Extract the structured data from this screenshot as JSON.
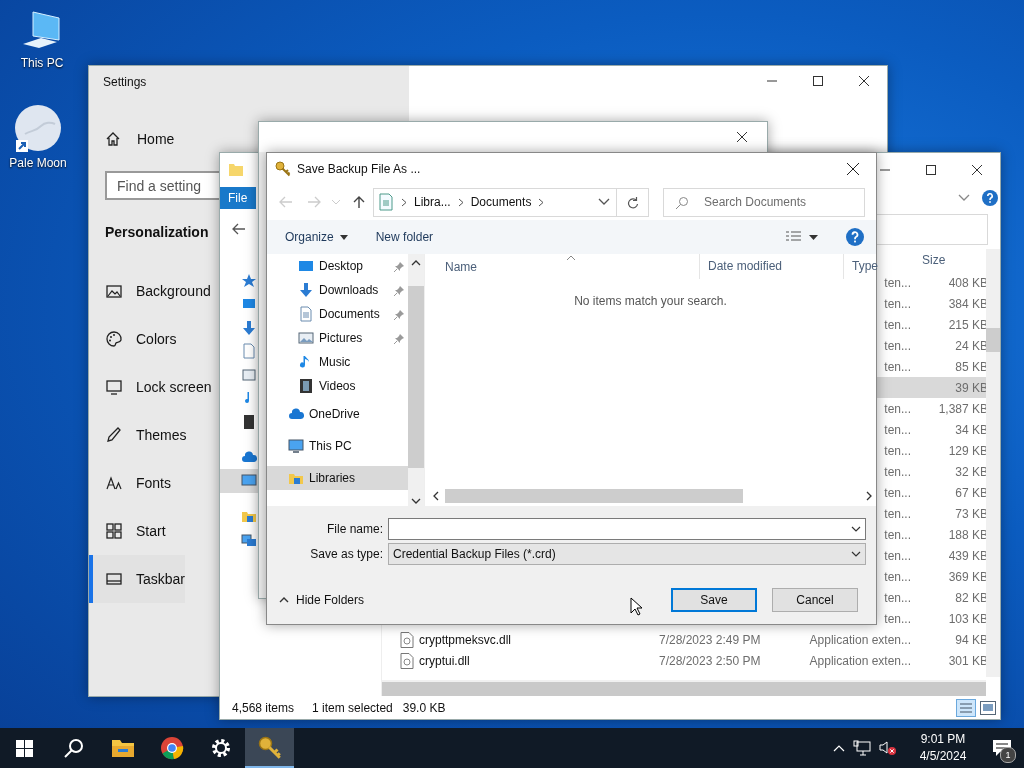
{
  "desktop_icons": [
    {
      "label": "This PC"
    },
    {
      "label": "Pale Moon"
    }
  ],
  "settings": {
    "title": "Settings",
    "home": "Home",
    "search": {
      "placeholder": "Find a setting"
    },
    "section": "Personalization",
    "items": [
      {
        "label": "Background",
        "selected": false
      },
      {
        "label": "Colors",
        "selected": false
      },
      {
        "label": "Lock screen",
        "selected": false
      },
      {
        "label": "Themes",
        "selected": false
      },
      {
        "label": "Fonts",
        "selected": false
      },
      {
        "label": "Start",
        "selected": false
      },
      {
        "label": "Taskbar",
        "selected": true
      }
    ]
  },
  "explorer": {
    "ribbon_tab": "File",
    "size_column": "Size",
    "nav_items": [
      {
        "selected": false
      },
      {
        "selected": false
      },
      {
        "selected": false
      },
      {
        "selected": false
      },
      {
        "selected": false
      },
      {
        "selected": false
      },
      {
        "selected": false
      },
      {
        "selected": false
      },
      {
        "selected": true
      },
      {
        "selected": false
      },
      {
        "selected": false
      }
    ],
    "rows": [
      {
        "type": "ten...",
        "size": "408 KB",
        "selected": false
      },
      {
        "type": "ten...",
        "size": "384 KB",
        "selected": false
      },
      {
        "type": "ten...",
        "size": "215 KB",
        "selected": false
      },
      {
        "type": "ten...",
        "size": "24 KB",
        "selected": false
      },
      {
        "type": "ten...",
        "size": "85 KB",
        "selected": false
      },
      {
        "size": "39 KB",
        "selected": true
      },
      {
        "type": "ten...",
        "size": "1,387 KB",
        "selected": false
      },
      {
        "type": "ten...",
        "size": "34 KB",
        "selected": false
      },
      {
        "type": "ten...",
        "size": "129 KB",
        "selected": false
      },
      {
        "type": "ten...",
        "size": "32 KB",
        "selected": false
      },
      {
        "type": "ten...",
        "size": "67 KB",
        "selected": false
      },
      {
        "type": "ten...",
        "size": "73 KB",
        "selected": false
      },
      {
        "type": "ten...",
        "size": "188 KB",
        "selected": false
      },
      {
        "type": "ten...",
        "size": "439 KB",
        "selected": false
      },
      {
        "type": "ten...",
        "size": "369 KB",
        "selected": false
      },
      {
        "type": "ten...",
        "size": "82 KB",
        "selected": false
      },
      {
        "type": "ten...",
        "size": "103 KB",
        "selected": false
      },
      {
        "name": "crypttpmeksvc.dll",
        "date": "7/28/2023 2:49 PM",
        "type": "Application exten...",
        "size": "94 KB",
        "selected": false
      },
      {
        "name": "cryptui.dll",
        "date": "7/28/2023 2:50 PM",
        "type": "Application exten...",
        "size": "301 KB",
        "selected": false
      }
    ],
    "status": {
      "count": "4,568 items",
      "selection": "1 item selected",
      "size": "39.0 KB"
    }
  },
  "dialog": {
    "title": "Save Backup File As ...",
    "path": [
      "Libra...",
      "Documents"
    ],
    "search": {
      "placeholder": "Search Documents"
    },
    "toolbar": {
      "organize": "Organize",
      "new_folder": "New folder"
    },
    "nav": [
      {
        "label": "Desktop",
        "pinned": true,
        "sub": true,
        "selected": false
      },
      {
        "label": "Downloads",
        "pinned": true,
        "sub": true,
        "selected": false
      },
      {
        "label": "Documents",
        "pinned": true,
        "sub": true,
        "selected": false
      },
      {
        "label": "Pictures",
        "pinned": true,
        "sub": true,
        "selected": false
      },
      {
        "label": "Music",
        "pinned": false,
        "sub": true,
        "selected": false
      },
      {
        "label": "Videos",
        "pinned": false,
        "sub": true,
        "selected": false
      },
      {
        "label": "OneDrive",
        "pinned": false,
        "sub": false,
        "selected": false
      },
      {
        "label": "This PC",
        "pinned": false,
        "sub": false,
        "selected": false
      },
      {
        "label": "Libraries",
        "pinned": false,
        "sub": false,
        "selected": true
      }
    ],
    "columns": [
      "Name",
      "Date modified",
      "Type"
    ],
    "empty_message": "No items match your search.",
    "file_name_label": "File name:",
    "type_label": "Save as type:",
    "type_value": "Credential Backup Files (*.crd)",
    "hide_folders": "Hide Folders",
    "buttons": [
      "Save",
      "Cancel"
    ]
  },
  "taskbar": {
    "time": "9:01 PM",
    "date": "4/5/2024",
    "notifications": "1"
  }
}
